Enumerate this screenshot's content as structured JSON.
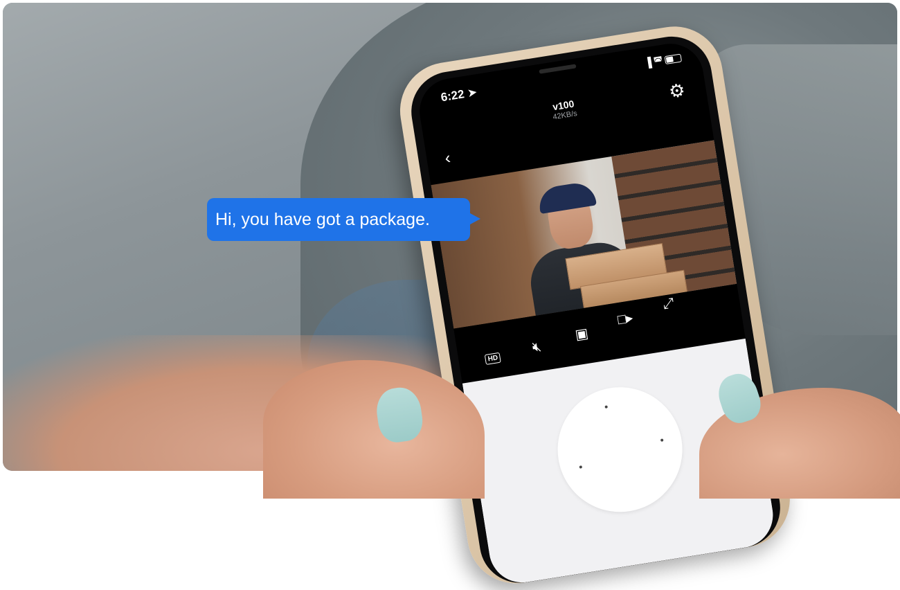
{
  "speech_bubble": {
    "text": "Hi, you have got a package.",
    "color": "#1f73e8"
  },
  "phone": {
    "status_bar": {
      "time": "6:22",
      "location_icon": "location-arrow-icon",
      "signal_icon": "signal-icon",
      "wifi_icon": "wifi-icon",
      "battery_icon": "battery-icon"
    },
    "header": {
      "device_name": "v100",
      "bitrate": "42KB/s",
      "back_icon": "chevron-left-icon",
      "settings_icon": "gear-icon"
    },
    "video_controls": {
      "hd_label": "HD",
      "icons": [
        "mute-icon",
        "camera-icon",
        "video-record-icon",
        "fullscreen-icon"
      ]
    }
  }
}
